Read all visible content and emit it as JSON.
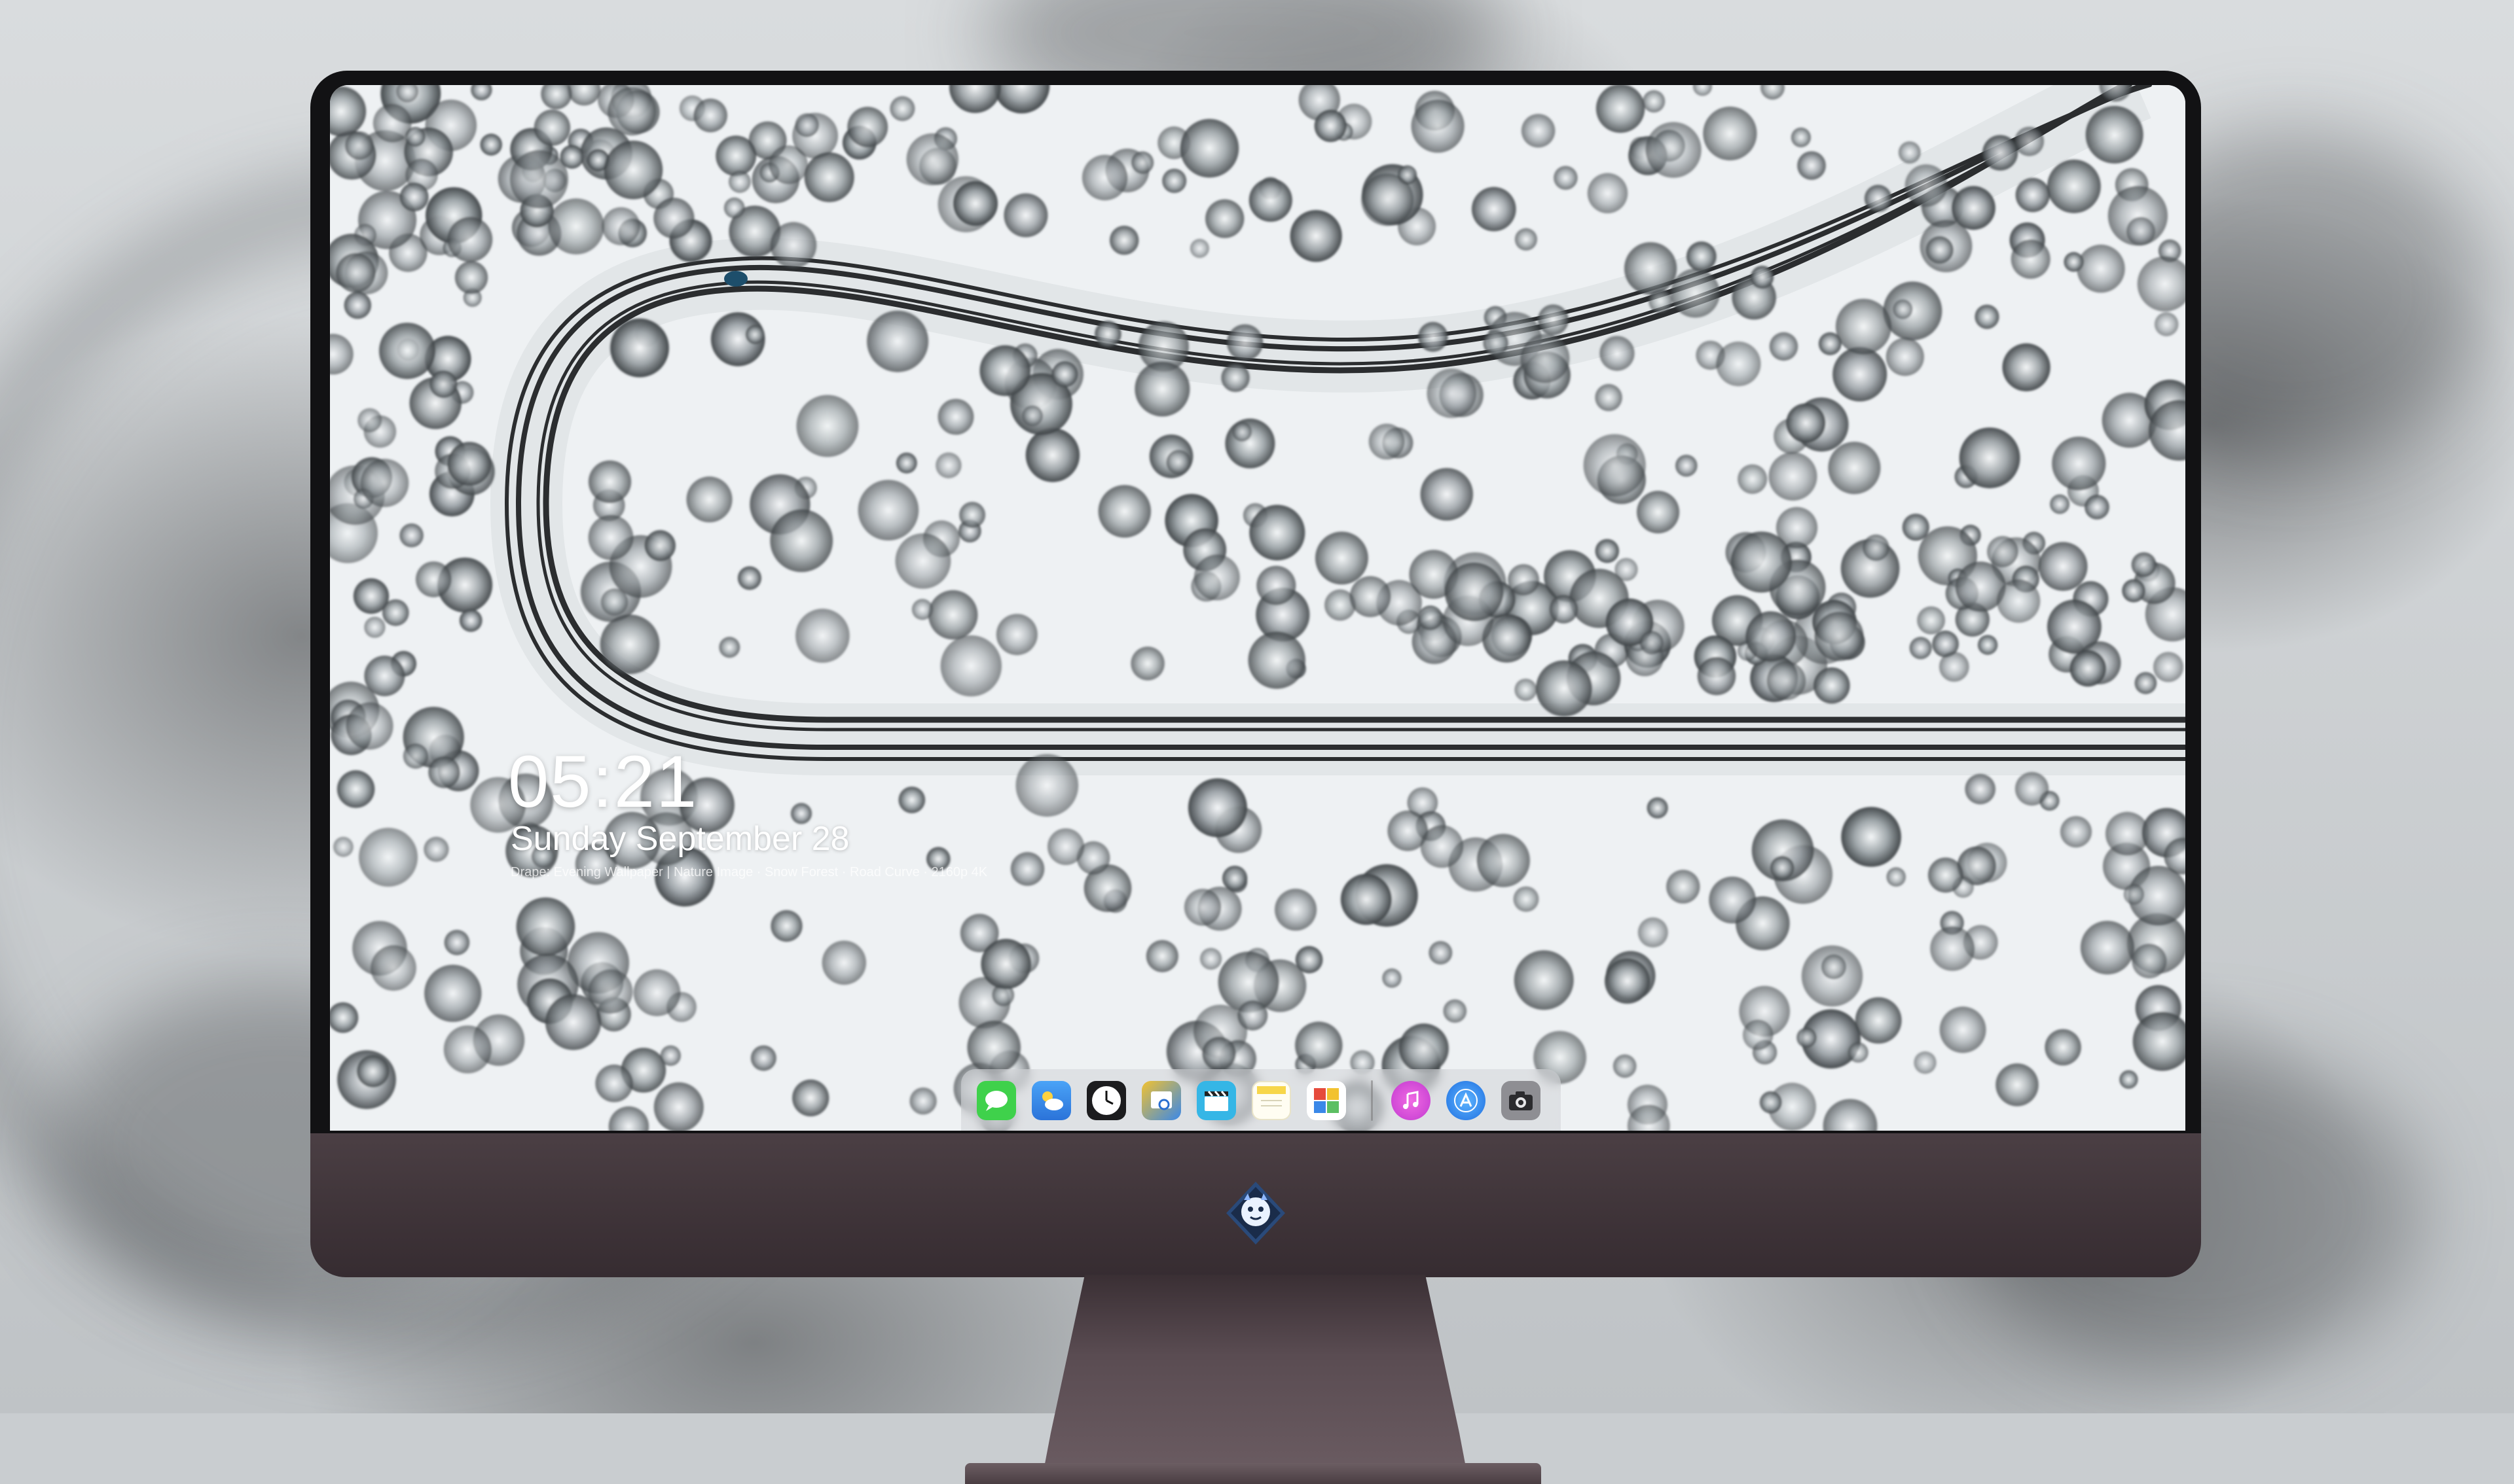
{
  "lock_screen": {
    "time": "05:21",
    "date": "Sunday September  28",
    "caption": "Drape: Evening Wallpaper | Nature Image · Snow Forest · Road Curve · 2160p 4K"
  },
  "dock": {
    "apps": [
      {
        "name": "Messages",
        "icon": "messages-icon",
        "color": "#3fd14b"
      },
      {
        "name": "Weather",
        "icon": "weather-icon",
        "color": "#3a8ff2"
      },
      {
        "name": "Clock",
        "icon": "clock-icon",
        "color": "#1c1c1e"
      },
      {
        "name": "Preview",
        "icon": "preview-icon",
        "color": "#f2c230"
      },
      {
        "name": "Clapper",
        "icon": "clapper-icon",
        "color": "#35b6e6"
      },
      {
        "name": "Notes",
        "icon": "notes-icon",
        "color": "#f7d64a"
      },
      {
        "name": "Photos",
        "icon": "photos-icon",
        "color": "#5cbf62"
      }
    ],
    "pinned": [
      {
        "name": "Music",
        "icon": "music-icon",
        "color": "#e64bd6"
      },
      {
        "name": "App Store",
        "icon": "app-store-icon",
        "color": "#2f8ff5"
      },
      {
        "name": "Camera",
        "icon": "camera-icon",
        "color": "#8e8e93"
      }
    ]
  },
  "monitor": {
    "chin_logo": "dragon-mascot-logo"
  }
}
